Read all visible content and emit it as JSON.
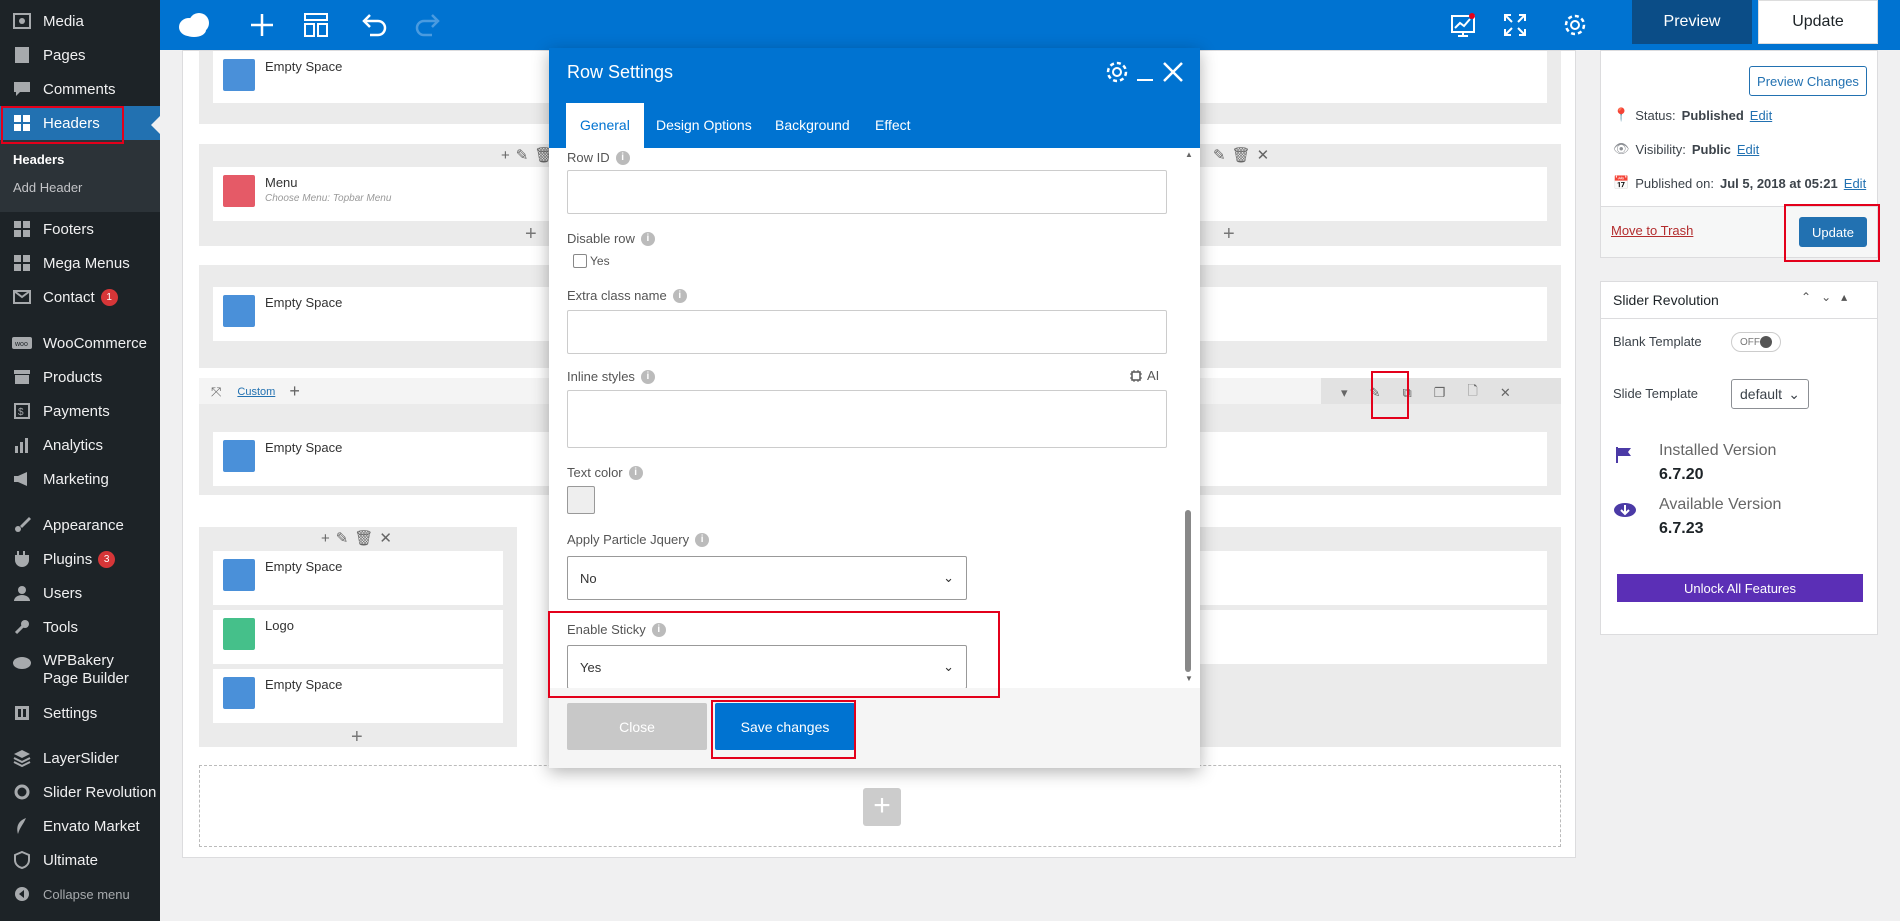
{
  "sidebar": {
    "items": [
      {
        "label": "Media",
        "icon": "media-icon"
      },
      {
        "label": "Pages",
        "icon": "pages-icon"
      },
      {
        "label": "Comments",
        "icon": "comments-icon"
      },
      {
        "label": "Headers",
        "icon": "grid-icon"
      },
      {
        "label": "Footers",
        "icon": "grid-icon"
      },
      {
        "label": "Mega Menus",
        "icon": "grid-icon"
      },
      {
        "label": "Contact",
        "icon": "mail-icon",
        "badge": "1"
      },
      {
        "label": "WooCommerce",
        "icon": "woo-icon"
      },
      {
        "label": "Products",
        "icon": "archive-icon"
      },
      {
        "label": "Payments",
        "icon": "dollar-icon"
      },
      {
        "label": "Analytics",
        "icon": "chart-icon"
      },
      {
        "label": "Marketing",
        "icon": "megaphone-icon"
      },
      {
        "label": "Appearance",
        "icon": "brush-icon"
      },
      {
        "label": "Plugins",
        "icon": "plugin-icon",
        "badge": "3"
      },
      {
        "label": "Users",
        "icon": "user-icon"
      },
      {
        "label": "Tools",
        "icon": "wrench-icon"
      },
      {
        "label": "WPBakery Page Builder",
        "icon": "cloud-icon"
      },
      {
        "label": "Settings",
        "icon": "settings-icon"
      },
      {
        "label": "LayerSlider",
        "icon": "layers-icon"
      },
      {
        "label": "Slider Revolution",
        "icon": "refresh-icon"
      },
      {
        "label": "Envato Market",
        "icon": "leaf-icon"
      },
      {
        "label": "Ultimate",
        "icon": "shield-icon"
      },
      {
        "label": "Collapse menu",
        "icon": "collapse-icon"
      }
    ],
    "submenu": [
      "Headers",
      "Add Header"
    ]
  },
  "toolbar": {
    "preview": "Preview",
    "update": "Update"
  },
  "canvas": {
    "empty_space": "Empty Space",
    "menu": "Menu",
    "menu_sub": "Choose Menu: Topbar Menu",
    "logo": "Logo",
    "custom": "Custom"
  },
  "modal": {
    "title": "Row Settings",
    "tabs": [
      "General",
      "Design Options",
      "Background",
      "Effect"
    ],
    "row_id": "Row ID",
    "disable_row": "Disable row",
    "yes": "Yes",
    "extra_class": "Extra class name",
    "inline_styles": "Inline styles",
    "ai": "AI",
    "text_color": "Text color",
    "particle": "Apply Particle Jquery",
    "particle_value": "No",
    "sticky": "Enable Sticky",
    "sticky_value": "Yes",
    "close": "Close",
    "save": "Save changes"
  },
  "publish": {
    "preview_changes": "Preview Changes",
    "status_label": "Status:",
    "status": "Published",
    "visibility_label": "Visibility:",
    "visibility": "Public",
    "published_label": "Published on:",
    "published": "Jul 5, 2018 at 05:21",
    "edit": "Edit",
    "trash": "Move to Trash",
    "update": "Update"
  },
  "slider": {
    "title": "Slider Revolution",
    "blank_template": "Blank Template",
    "off": "OFF",
    "slide_template": "Slide Template",
    "default": "default",
    "installed_label": "Installed Version",
    "installed": "6.7.20",
    "available_label": "Available Version",
    "available": "6.7.23",
    "unlock": "Unlock All Features"
  }
}
